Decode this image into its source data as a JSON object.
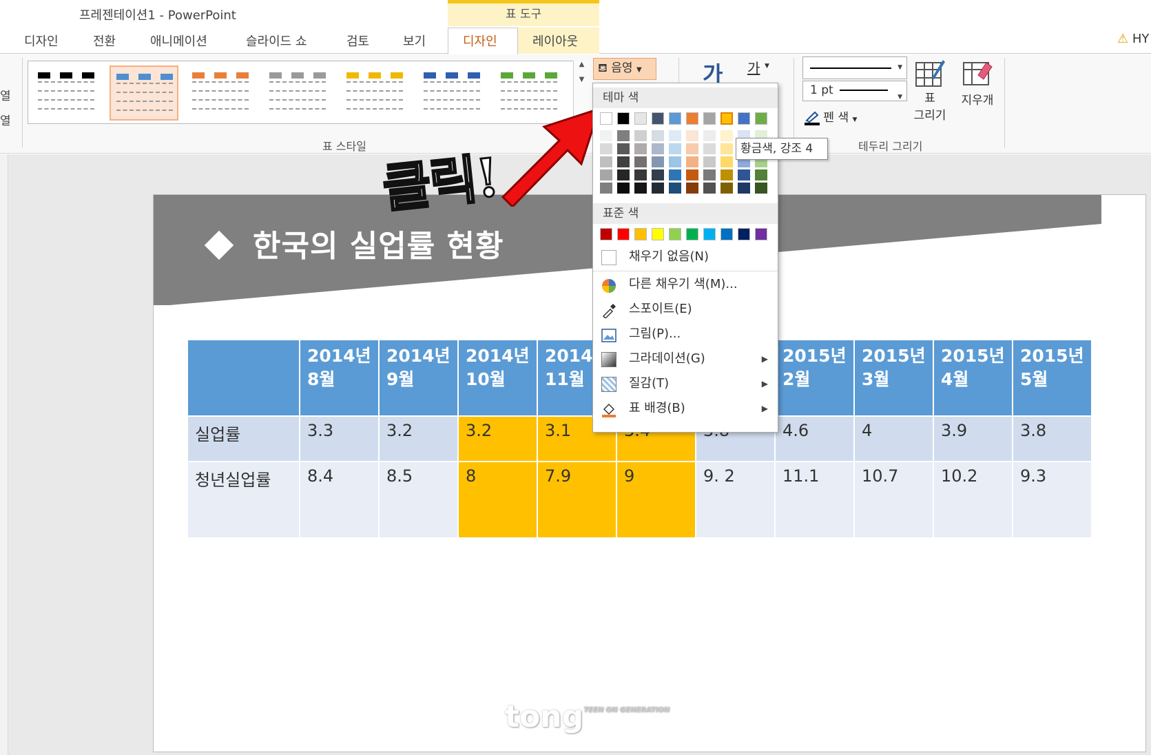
{
  "window": {
    "title": "프레젠테이션1 - PowerPoint",
    "context_group": "표 도구"
  },
  "tabs": [
    {
      "label": "디자인"
    },
    {
      "label": "전환"
    },
    {
      "label": "애니메이션"
    },
    {
      "label": "슬라이드 쇼"
    },
    {
      "label": "검토"
    },
    {
      "label": "보기"
    },
    {
      "label": "디자인"
    },
    {
      "label": "레이아웃"
    }
  ],
  "warning_text": "HY",
  "ribbon": {
    "left_cut": [
      "열",
      "열"
    ],
    "table_style_group_label": "표 스타일",
    "shading_button": "음영",
    "ga_large": "가",
    "ga_small": "가",
    "line_weight": "1 pt",
    "pen_color": "펜 색",
    "draw_table": [
      "표",
      "그리기"
    ],
    "eraser": "지우개",
    "border_group_label": "테두리 그리기",
    "style_thumb_colors": [
      "#000000",
      "#4f8fd0",
      "#e8803a",
      "#9a9a9a",
      "#f2b800",
      "#2f5fb0",
      "#5aa83a"
    ]
  },
  "shading_menu": {
    "theme_colors_label": "테마 색",
    "theme_colors": [
      "#ffffff",
      "#000000",
      "#e7e6e6",
      "#44546a",
      "#5b9bd5",
      "#ed7d31",
      "#a5a5a5",
      "#ffc000",
      "#4472c4",
      "#70ad47"
    ],
    "shade_columns": [
      [
        "#f2f2f2",
        "#d9d9d9",
        "#bfbfbf",
        "#a6a6a6",
        "#7f7f7f"
      ],
      [
        "#7f7f7f",
        "#595959",
        "#404040",
        "#262626",
        "#0d0d0d"
      ],
      [
        "#d0cece",
        "#afabab",
        "#757171",
        "#3a3838",
        "#171616"
      ],
      [
        "#d6dce4",
        "#adb9ca",
        "#8497b0",
        "#333f4f",
        "#222a35"
      ],
      [
        "#deebf6",
        "#bdd7ee",
        "#9dc3e6",
        "#2e75b5",
        "#1f4e79"
      ],
      [
        "#fbe5d5",
        "#f7cbac",
        "#f4b183",
        "#c55a11",
        "#843c0b"
      ],
      [
        "#ededed",
        "#dbdbdb",
        "#c9c9c9",
        "#7b7b7b",
        "#525252"
      ],
      [
        "#fff2cc",
        "#ffe599",
        "#ffd966",
        "#bf9000",
        "#7f6000"
      ],
      [
        "#dae3f3",
        "#b4c7e7",
        "#8faadc",
        "#2f5597",
        "#203864"
      ],
      [
        "#e2efd9",
        "#c5e0b3",
        "#a8d08d",
        "#538135",
        "#375623"
      ]
    ],
    "standard_colors_label": "표준 색",
    "standard_colors": [
      "#c00000",
      "#ff0000",
      "#ffc000",
      "#ffff00",
      "#92d050",
      "#00b050",
      "#00b0f0",
      "#0070c0",
      "#002060",
      "#7030a0"
    ],
    "no_fill": "채우기 없음(N)",
    "more_colors": "다른 채우기 색(M)...",
    "eyedropper": "스포이트(E)",
    "picture": "그림(P)...",
    "gradient": "그라데이션(G)",
    "texture": "질감(T)",
    "table_background": "표 배경(B)"
  },
  "tooltip": "황금색, 강조 4",
  "annotation": {
    "text": "클릭!"
  },
  "slide": {
    "title": "한국의 실업률 현황",
    "table": {
      "headers": [
        "",
        "2014년 8월",
        "2014년 9월",
        "2014년 10월",
        "2014년 11월",
        "",
        "",
        "2015년 2월",
        "2015년 3월",
        "2015년 4월",
        "2015년 5월"
      ],
      "rows": [
        {
          "label": "실업률",
          "values": [
            "3.3",
            "3.2",
            "3.2",
            "3.1",
            "3.4",
            "3.8",
            "4.6",
            "4",
            "3.9",
            "3.8"
          ]
        },
        {
          "label": "청년실업률",
          "values": [
            "8.4",
            "8.5",
            "8",
            "7.9",
            "9",
            "9. 2",
            "11.1",
            "10.7",
            "10.2",
            "9.3"
          ]
        }
      ]
    },
    "watermark": "tong",
    "watermark_sub": "TEEN ON GENERATION"
  }
}
